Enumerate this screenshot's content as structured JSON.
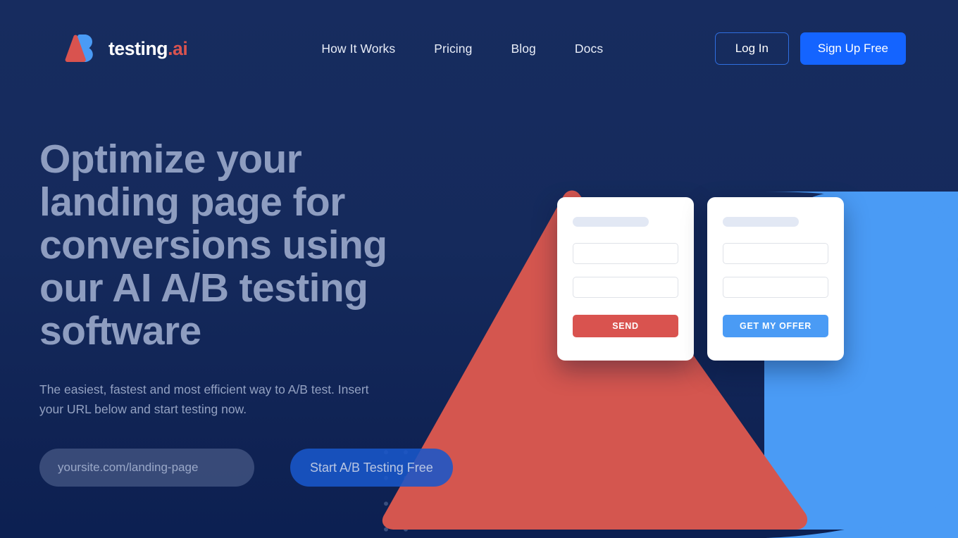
{
  "brand": {
    "name": "testing",
    "suffix": ".ai",
    "logo_icon": "ab-logo-icon",
    "accent_red": "#d9534f",
    "accent_blue": "#4a9bf5",
    "primary_blue": "#1464ff",
    "background_navy": "#152a5c"
  },
  "nav": {
    "items": [
      {
        "label": "How It Works"
      },
      {
        "label": "Pricing"
      },
      {
        "label": "Blog"
      },
      {
        "label": "Docs"
      }
    ],
    "login_label": "Log In",
    "signup_label": "Sign Up Free"
  },
  "hero": {
    "title": "Optimize your landing page for conversions using our AI A/B testing software",
    "subtitle": "The easiest, fastest and most efficient way to A/B test. Insert your URL below and start testing now.",
    "url_placeholder": "yoursite.com/landing-page",
    "url_value": "",
    "cta_label": "Start A/B Testing Free"
  },
  "mock_cards": [
    {
      "variant": "A",
      "button_label": "SEND",
      "button_color": "#d9534f",
      "fields": 2
    },
    {
      "variant": "B",
      "button_label": "GET MY OFFER",
      "button_color": "#4a9bf5",
      "fields": 2
    }
  ],
  "decor": {
    "triangle_color": "#d4564f",
    "blob_color": "#4a9bf5",
    "dot_color": "#3a4f7e"
  }
}
